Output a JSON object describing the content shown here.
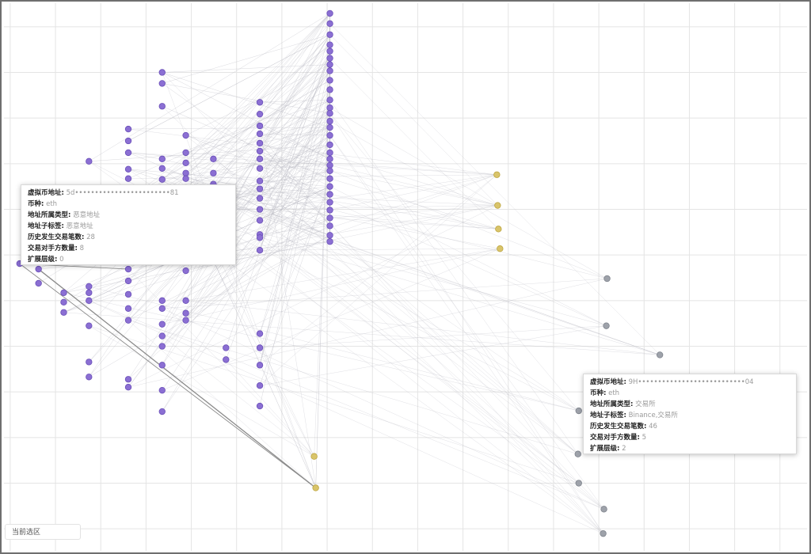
{
  "colors": {
    "grid": "#e4e4e4",
    "edge": "#b9b9c2",
    "edge_strong": "#8a8a8a",
    "node_purple": "#8b6fd3",
    "node_purple_stroke": "#6a4fb8",
    "node_yellow": "#d9c46a",
    "node_yellow_stroke": "#bda640",
    "node_gray": "#9ea2aa",
    "node_gray_stroke": "#7d828b"
  },
  "tooltips": {
    "left": {
      "address_label": "虚拟币地址:",
      "address_value": "5d••••••••••••••••••••••••81",
      "coin_label": "币种:",
      "coin_value": "eth",
      "type_label": "地址所属类型:",
      "type_value": "恶意地址",
      "subtag_label": "地址子标签:",
      "subtag_value": "恶意地址",
      "tx_count_label": "历史发生交易笔数:",
      "tx_count_value": "28",
      "counterparty_label": "交易对手方数量:",
      "counterparty_value": "8",
      "level_label": "扩展层级:",
      "level_value": "0"
    },
    "right": {
      "address_label": "虚拟币地址:",
      "address_value": "9H•••••••••••••••••••••••••••04",
      "coin_label": "币种:",
      "coin_value": "eth",
      "type_label": "地址所属类型:",
      "type_value": "交易所",
      "subtag_label": "地址子标签:",
      "subtag_value": "Binance,交易所",
      "tx_count_label": "历史发生交易笔数:",
      "tx_count_value": "46",
      "counterparty_label": "交易对手方数量:",
      "counterparty_value": "5",
      "level_label": "扩展层级:",
      "level_value": "2"
    }
  },
  "selection_label": "当前选区"
}
